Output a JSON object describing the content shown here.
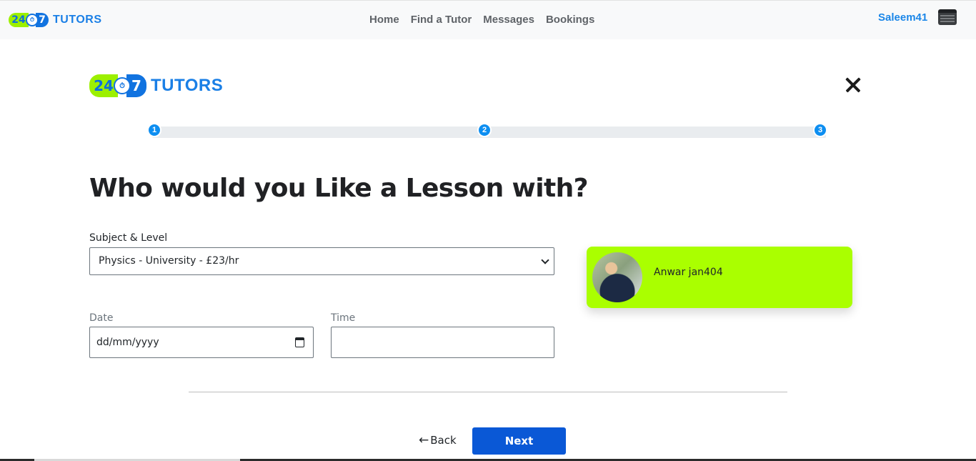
{
  "brand": {
    "num_left": "24",
    "num_right": "7",
    "clock_glyph": "⏱",
    "word": "TUTORS"
  },
  "nav": {
    "links": [
      "Home",
      "Find a Tutor",
      "Messages",
      "Bookings"
    ],
    "username": "Saleem41",
    "user_icon": "user-menu-icon"
  },
  "wizard": {
    "steps": [
      "1",
      "2",
      "3"
    ],
    "current_step": 3,
    "heading": "Who would you Like a Lesson with?",
    "subject": {
      "label": "Subject & Level",
      "value": "Physics - University - £23/hr"
    },
    "date": {
      "label": "Date",
      "placeholder": "dd/mm/yyyy"
    },
    "time": {
      "label": "Time",
      "value": ""
    },
    "tutor": {
      "name": "Anwar jan404"
    },
    "back_label": "Back",
    "back_arrow": "←",
    "next_label": "Next"
  },
  "colors": {
    "accent": "#0a58d6",
    "brand_green": "#aaff00",
    "step_blue": "#0d8ef1",
    "username_blue": "#1a86e8"
  }
}
